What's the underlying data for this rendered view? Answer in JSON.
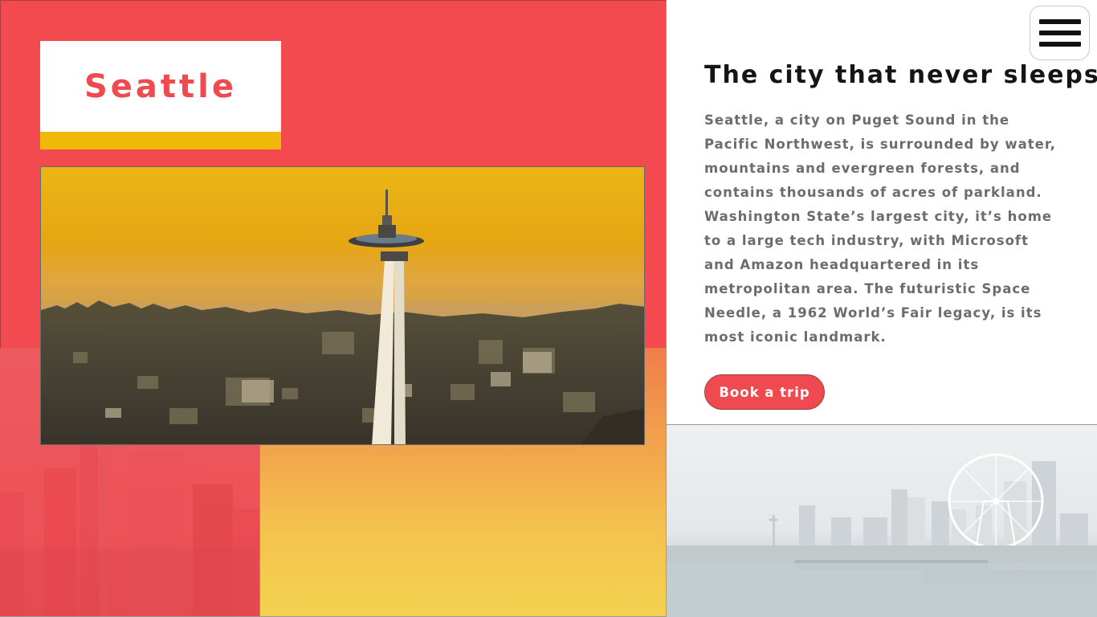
{
  "hero": {
    "city_title": "Seattle",
    "photo_subject": "space-needle-sunset-photo"
  },
  "content": {
    "heading": "The city that never sleeps",
    "description": "Seattle, a city on Puget Sound in the Pacific Northwest, is surrounded by water, mountains and evergreen forests, and contains thousands of acres of parkland. Washington State’s largest city, it’s home to a large tech industry, with Microsoft and Amazon headquartered in its metropolitan area. The futuristic Space Needle, a 1962 World’s Fair legacy, is its most iconic landmark.",
    "book_button": "Book a trip"
  },
  "menu": {
    "icon": "hamburger-menu-icon"
  },
  "colors": {
    "brand_red": "#ee4a4f",
    "accent_yellow": "#f0b90a",
    "heading_text": "#151515",
    "body_text": "#6c6c6c"
  }
}
